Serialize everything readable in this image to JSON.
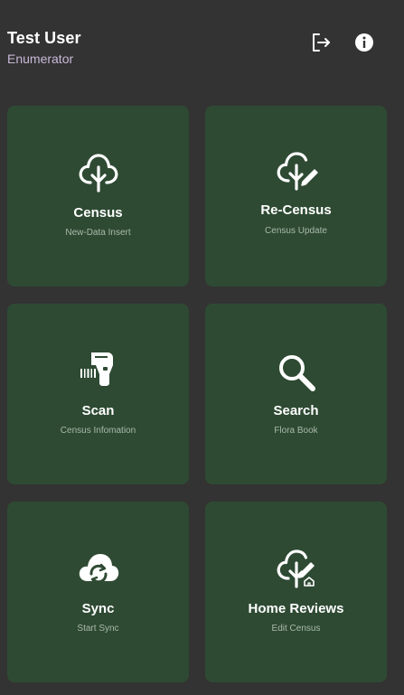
{
  "header": {
    "user_name": "Test User",
    "role": "Enumerator",
    "logout_icon": "logout-icon",
    "info_icon": "info-icon"
  },
  "cards": [
    {
      "title": "Census",
      "subtitle": "New-Data Insert",
      "icon": "tree-icon"
    },
    {
      "title": "Re-Census",
      "subtitle": "Census Update",
      "icon": "tree-edit-icon"
    },
    {
      "title": "Scan",
      "subtitle": "Census Infomation",
      "icon": "barcode-scanner-icon"
    },
    {
      "title": "Search",
      "subtitle": "Flora Book",
      "icon": "magnifier-icon"
    },
    {
      "title": "Sync",
      "subtitle": "Start Sync",
      "icon": "cloud-sync-icon"
    },
    {
      "title": "Home Reviews",
      "subtitle": "Edit Census",
      "icon": "tree-home-edit-icon"
    }
  ],
  "colors": {
    "background": "#333333",
    "card": "#2e4a33",
    "role_text": "#c8b8d8",
    "subtitle_text": "#a9b9ab"
  }
}
